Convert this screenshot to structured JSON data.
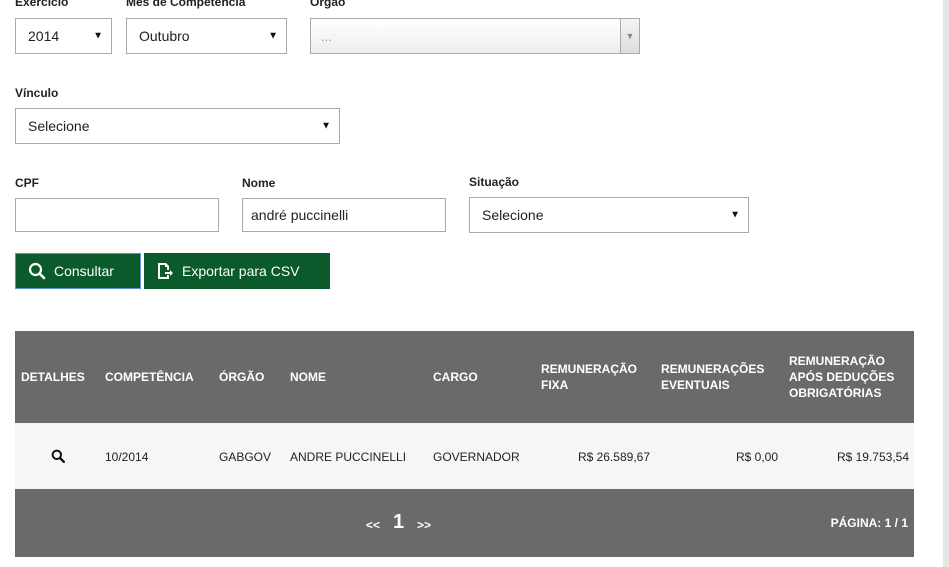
{
  "filters": {
    "exercicio": {
      "label": "Exercício",
      "value": "2014"
    },
    "mes": {
      "label": "Mês de Competência",
      "value": "Outubro"
    },
    "orgao": {
      "label": "Órgão",
      "value": "..."
    },
    "vinculo": {
      "label": "Vínculo",
      "value": "Selecione"
    },
    "cpf": {
      "label": "CPF",
      "value": ""
    },
    "nome": {
      "label": "Nome",
      "value": "andré puccinelli"
    },
    "situacao": {
      "label": "Situação",
      "value": "Selecione"
    }
  },
  "actions": {
    "consultar": "Consultar",
    "exportar": "Exportar para CSV"
  },
  "table": {
    "headers": {
      "detalhes": "DETALHES",
      "competencia": "COMPETÊNCIA",
      "orgao": "ÓRGÃO",
      "nome": "NOME",
      "cargo": "CARGO",
      "rem_fixa_1": "REMUNERAÇÃO",
      "rem_fixa_2": "FIXA",
      "rem_event_1": "REMUNERAÇÕES",
      "rem_event_2": "EVENTUAIS",
      "rem_apos_1": "REMUNERAÇÃO",
      "rem_apos_2": "APÓS DEDUÇÕES",
      "rem_apos_3": "OBRIGATÓRIAS"
    },
    "rows": [
      {
        "competencia": "10/2014",
        "orgao": "GABGOV",
        "nome": "ANDRE PUCCINELLI",
        "cargo": "GOVERNADOR",
        "rem_fixa": "R$ 26.589,67",
        "rem_eventuais": "R$ 0,00",
        "rem_apos": "R$ 19.753,54"
      }
    ]
  },
  "pagination": {
    "prev": "<<",
    "current": "1",
    "next": ">>",
    "page_info": "PÁGINA: 1 / 1"
  },
  "colors": {
    "button_green": "#0b5a2c",
    "table_header": "#6a6a6a"
  }
}
